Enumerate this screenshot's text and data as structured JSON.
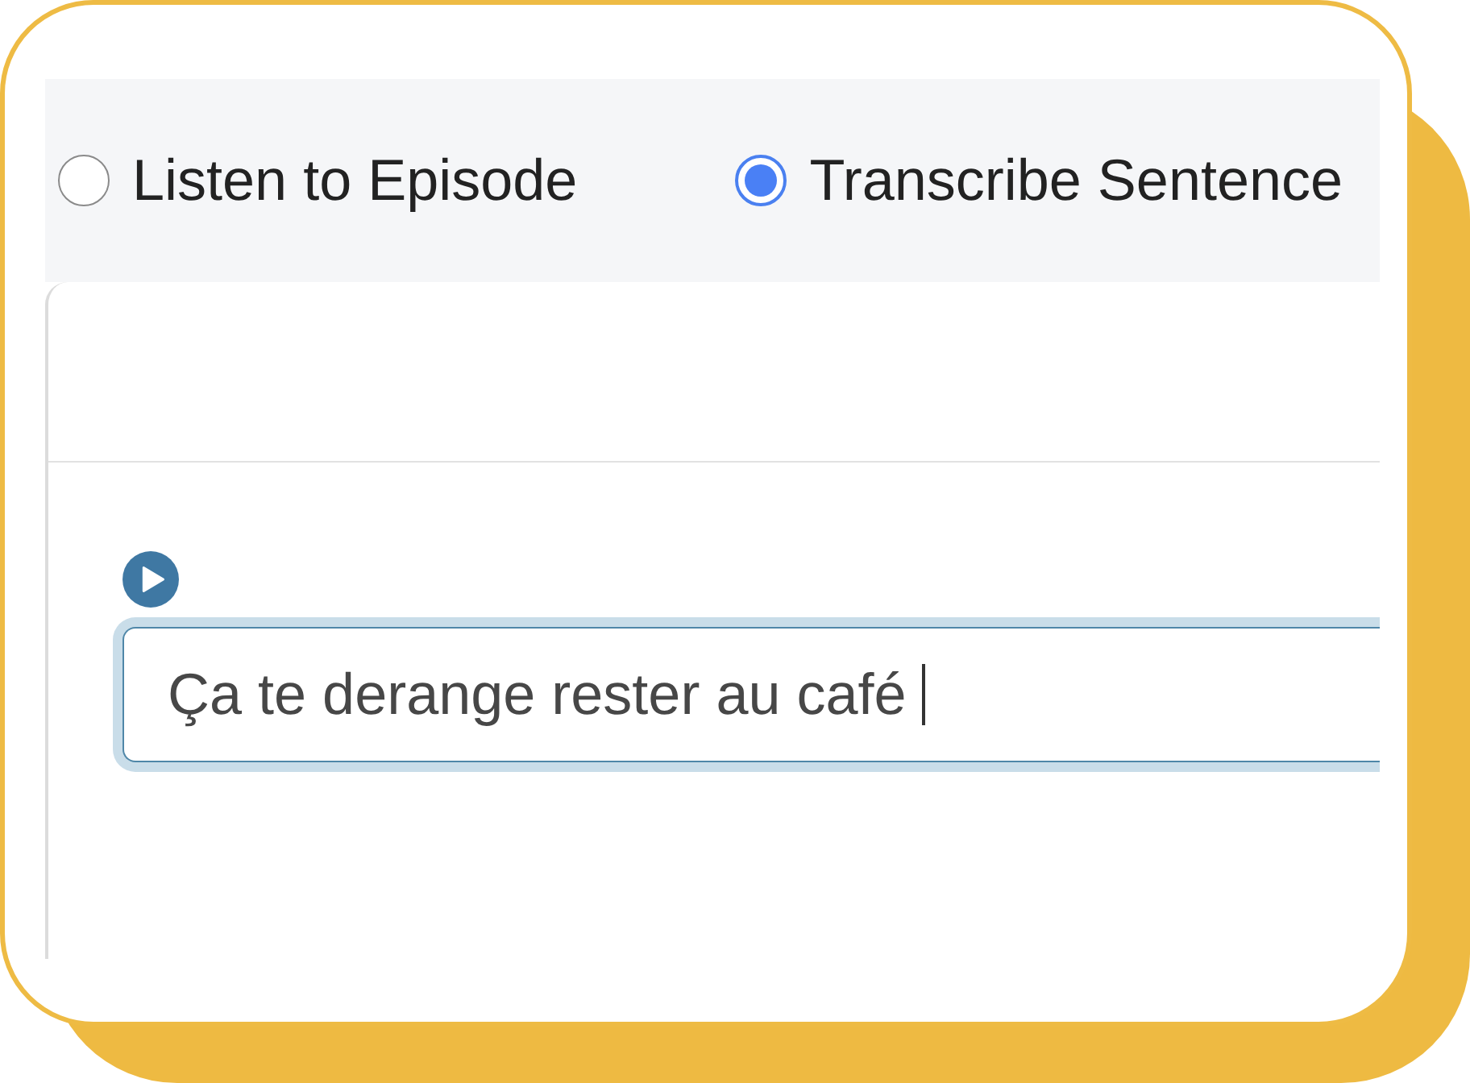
{
  "mode_options": [
    {
      "label": "Listen to Episode",
      "selected": false
    },
    {
      "label": "Transcribe Sentence",
      "selected": true
    }
  ],
  "transcription_input": {
    "value": "Ça te derange rester au café",
    "focused": true
  }
}
